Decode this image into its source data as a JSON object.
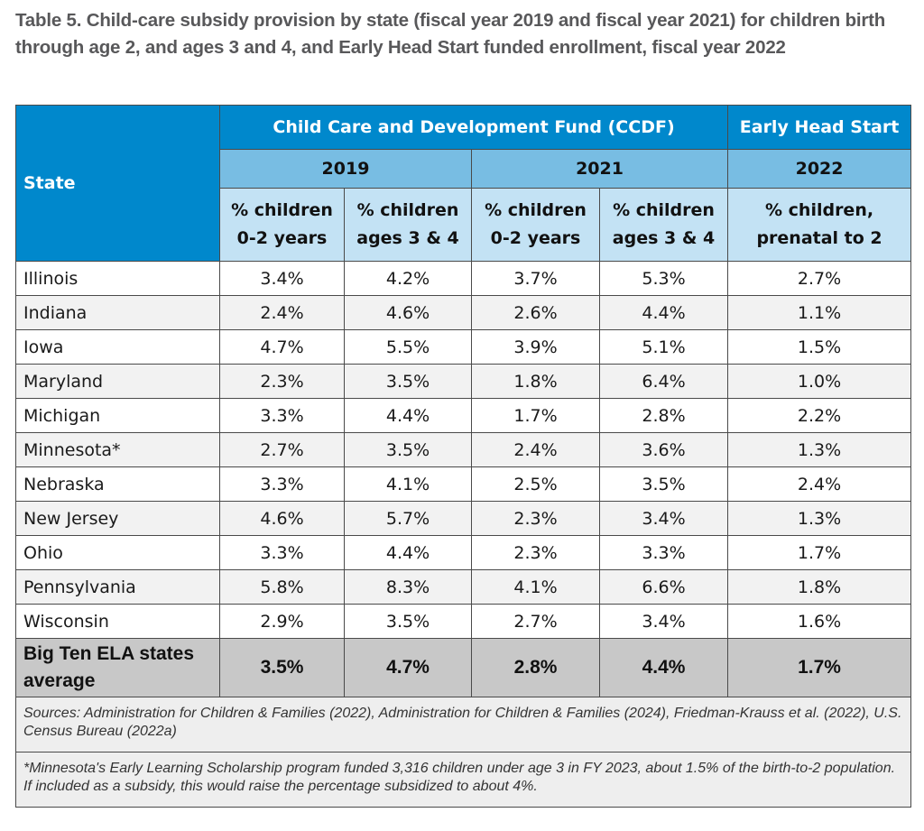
{
  "title": "Table 5. Child-care subsidy provision by state (fiscal year 2019 and fiscal year 2021) for children birth through age 2, and ages 3 and 4, and Early Head Start funded enrollment, fiscal year 2022",
  "header": {
    "state": "State",
    "ccdf": "Child Care and Development Fund (CCDF)",
    "ehs": "Early Head Start",
    "year_2019": "2019",
    "year_2021": "2021",
    "year_2022": "2022",
    "sub_0_2_2019_l1": "% children",
    "sub_0_2_2019_l2": "0-2 years",
    "sub_3_4_2019_l1": "% children",
    "sub_3_4_2019_l2": "ages 3 & 4",
    "sub_0_2_2021_l1": "% children",
    "sub_0_2_2021_l2": "0-2 years",
    "sub_3_4_2021_l1": "% children",
    "sub_3_4_2021_l2": "ages 3 & 4",
    "sub_ehs_l1": "% children,",
    "sub_ehs_l2": "prenatal to 2"
  },
  "rows": [
    {
      "state": "Illinois",
      "c2019_0_2": "3.4%",
      "c2019_3_4": "4.2%",
      "c2021_0_2": "3.7%",
      "c2021_3_4": "5.3%",
      "ehs2022": "2.7%"
    },
    {
      "state": "Indiana",
      "c2019_0_2": "2.4%",
      "c2019_3_4": "4.6%",
      "c2021_0_2": "2.6%",
      "c2021_3_4": "4.4%",
      "ehs2022": "1.1%"
    },
    {
      "state": "Iowa",
      "c2019_0_2": "4.7%",
      "c2019_3_4": "5.5%",
      "c2021_0_2": "3.9%",
      "c2021_3_4": "5.1%",
      "ehs2022": "1.5%"
    },
    {
      "state": "Maryland",
      "c2019_0_2": "2.3%",
      "c2019_3_4": "3.5%",
      "c2021_0_2": "1.8%",
      "c2021_3_4": "6.4%",
      "ehs2022": "1.0%"
    },
    {
      "state": "Michigan",
      "c2019_0_2": "3.3%",
      "c2019_3_4": "4.4%",
      "c2021_0_2": "1.7%",
      "c2021_3_4": "2.8%",
      "ehs2022": "2.2%"
    },
    {
      "state": "Minnesota*",
      "c2019_0_2": "2.7%",
      "c2019_3_4": "3.5%",
      "c2021_0_2": "2.4%",
      "c2021_3_4": "3.6%",
      "ehs2022": "1.3%"
    },
    {
      "state": "Nebraska",
      "c2019_0_2": "3.3%",
      "c2019_3_4": "4.1%",
      "c2021_0_2": "2.5%",
      "c2021_3_4": "3.5%",
      "ehs2022": "2.4%"
    },
    {
      "state": "New Jersey",
      "c2019_0_2": "4.6%",
      "c2019_3_4": "5.7%",
      "c2021_0_2": "2.3%",
      "c2021_3_4": "3.4%",
      "ehs2022": "1.3%"
    },
    {
      "state": "Ohio",
      "c2019_0_2": "3.3%",
      "c2019_3_4": "4.4%",
      "c2021_0_2": "2.3%",
      "c2021_3_4": "3.3%",
      "ehs2022": "1.7%"
    },
    {
      "state": "Pennsylvania",
      "c2019_0_2": "5.8%",
      "c2019_3_4": "8.3%",
      "c2021_0_2": "4.1%",
      "c2021_3_4": "6.6%",
      "ehs2022": "1.8%"
    },
    {
      "state": "Wisconsin",
      "c2019_0_2": "2.9%",
      "c2019_3_4": "3.5%",
      "c2021_0_2": "2.7%",
      "c2021_3_4": "3.4%",
      "ehs2022": "1.6%"
    }
  ],
  "average": {
    "state": "Big Ten ELA states average",
    "c2019_0_2": "3.5%",
    "c2019_3_4": "4.7%",
    "c2021_0_2": "2.8%",
    "c2021_3_4": "4.4%",
    "ehs2022": "1.7%"
  },
  "sources": "Sources: Administration for Children & Families (2022), Administration for Children & Families (2024), Friedman-Krauss et al. (2022), U.S. Census Bureau (2022a)",
  "footnote": "*Minnesota's Early Learning Scholarship program funded 3,316 children under age 3 in FY 2023, about 1.5% of the birth-to-2 population. If included as a subsidy, this would raise the percentage subsidized to about 4%.",
  "colors": {
    "header_dark": "#0088cc",
    "header_mid": "#78bde3",
    "header_light": "#c3e2f4",
    "avg_row": "#c8c8c8",
    "stripe": "#f2f2f2",
    "title_text": "#58585a"
  }
}
